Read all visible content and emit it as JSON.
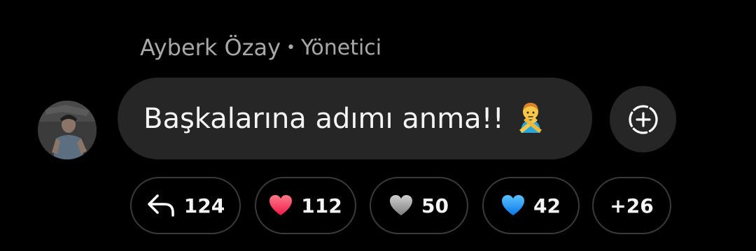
{
  "message": {
    "sender_name": "Ayberk Özay",
    "separator": "•",
    "sender_role": "Yönetici",
    "text": "Başkalarına adımı anma!!",
    "emoji": "person-gesturing-no-emoji"
  },
  "actions": {
    "add_reaction_icon": "add-reaction-icon"
  },
  "chips": [
    {
      "icon": "reply-icon",
      "count": "124"
    },
    {
      "icon": "red-heart-icon",
      "count": "112",
      "color": "#ff2d55"
    },
    {
      "icon": "grey-heart-icon",
      "count": "50",
      "color": "#9a9a9a"
    },
    {
      "icon": "blue-heart-icon",
      "count": "42",
      "color": "#1e90ff"
    },
    {
      "icon": "more-reactions",
      "count": "+26"
    }
  ],
  "colors": {
    "background": "#000000",
    "bubble": "#262626",
    "chip_border": "#3a3a3a",
    "muted_text": "#a8a8a8"
  }
}
